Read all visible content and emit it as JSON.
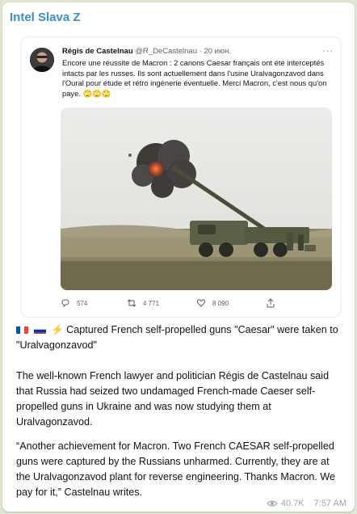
{
  "channel": {
    "name": "Intel Slava Z"
  },
  "tweet": {
    "author_name": "Régis de Castelnau",
    "author_handle": "@R_DeCastelnau",
    "date": "· 20 июн.",
    "more_label": "···",
    "text": "Encore une réussite de Macron : 2 canons Caesar français ont été interceptés intacts par les russes. Ils sont actuellement dans l'usine Uralvagonzavod dans l'Oural pour étude et rétro ingénerie éventuelle. Merci Macron, c'est nous qu'on paye. 🙄🙄🙄",
    "replies": "574",
    "retweets": "4 771",
    "likes": "8 090"
  },
  "message": {
    "headline": "⚡️ Captured French self-propelled guns \"Caesar\" were taken to \"Uralvagonzavod\"",
    "paragraph1": " The well-known French lawyer and politician Régis de Castelnau said that Russia had seized two undamaged French-made Caeser self-propelled guns in Ukraine and was now studying them at Uralvagonzavod.",
    "paragraph2": " “Another achievement for Macron.  Two French CAESAR self-propelled guns were captured by the Russians unharmed.  Currently, they are at the Uralvagonzavod plant for reverse engineering.  Thanks Macron.  We pay for it,” Castelnau writes."
  },
  "footer": {
    "views": "40.7K",
    "time": "7:57 AM"
  },
  "colors": {
    "channel": "#3a8fc7",
    "background": "#dfe7d2",
    "meta": "#9aa6ae"
  },
  "icons": [
    "eye-icon",
    "reply-icon",
    "retweet-icon",
    "like-icon",
    "share-icon",
    "flag-france-icon",
    "flag-russia-icon"
  ]
}
